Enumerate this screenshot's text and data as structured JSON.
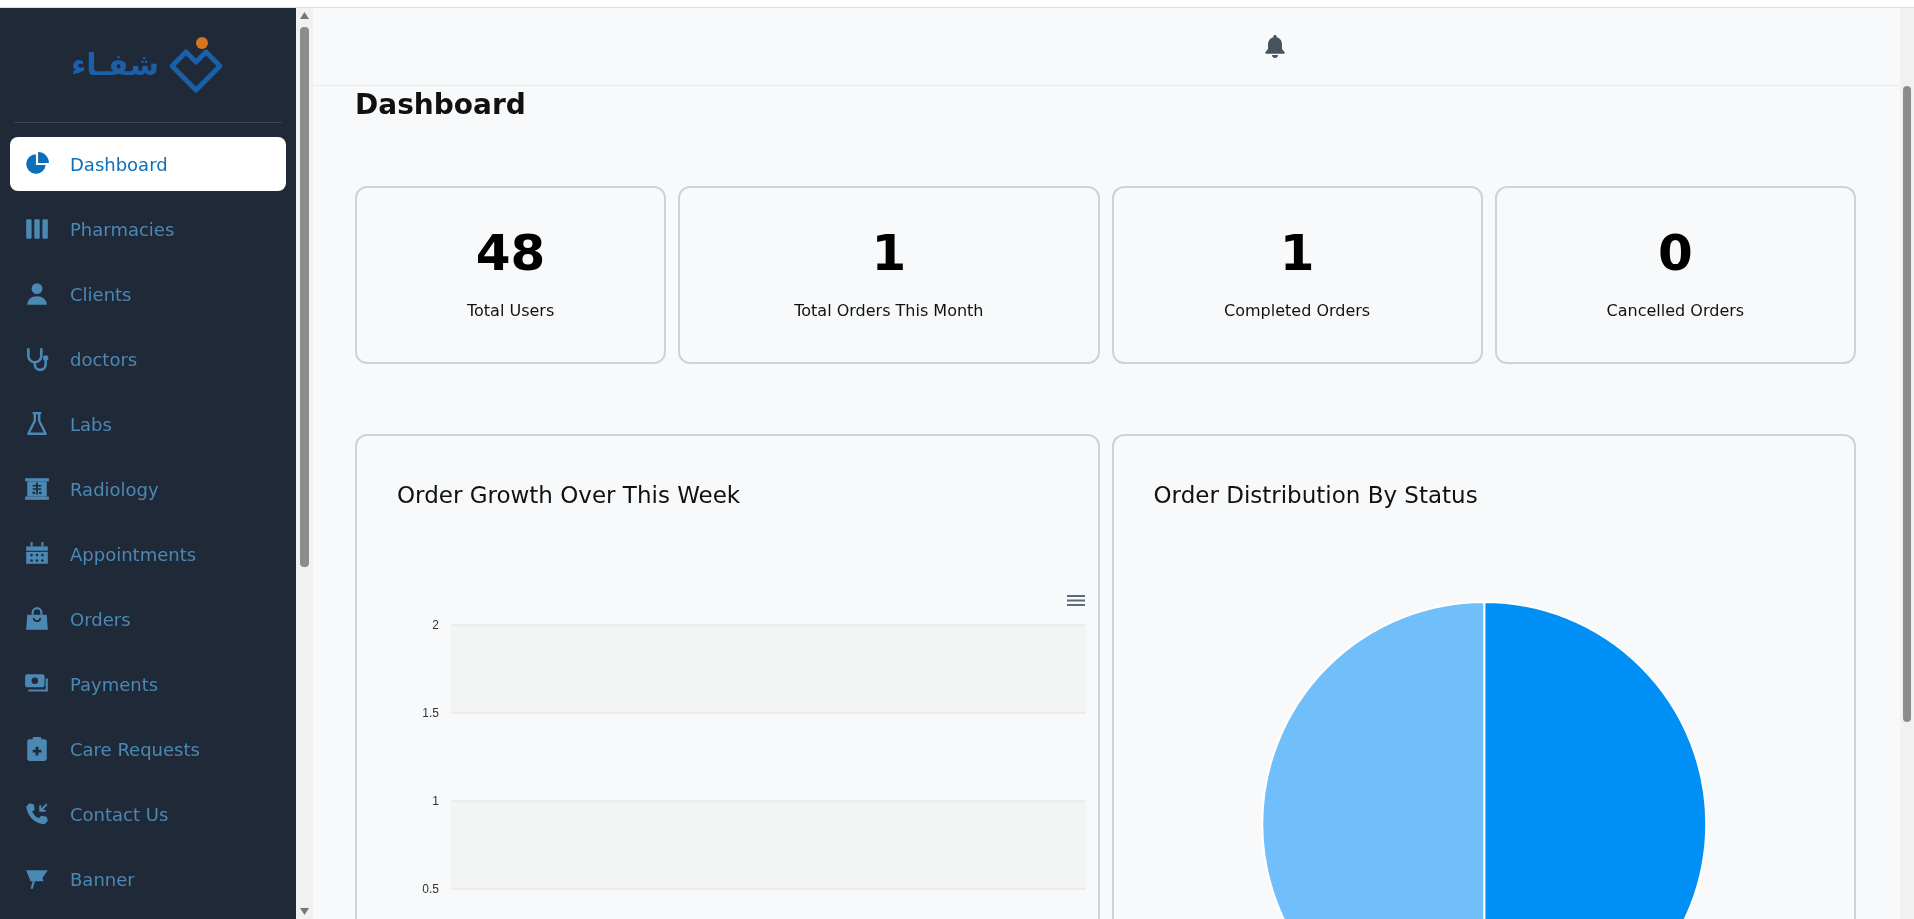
{
  "brand": {
    "name": "شفـاء"
  },
  "sidebar": {
    "items": [
      {
        "label": "Dashboard",
        "selected": true
      },
      {
        "label": "Pharmacies",
        "selected": false
      },
      {
        "label": "Clients",
        "selected": false
      },
      {
        "label": "doctors",
        "selected": false
      },
      {
        "label": "Labs",
        "selected": false
      },
      {
        "label": "Radiology",
        "selected": false
      },
      {
        "label": "Appointments",
        "selected": false
      },
      {
        "label": "Orders",
        "selected": false
      },
      {
        "label": "Payments",
        "selected": false
      },
      {
        "label": "Care Requests",
        "selected": false
      },
      {
        "label": "Contact Us",
        "selected": false
      },
      {
        "label": "Banner",
        "selected": false
      }
    ]
  },
  "page_title": "Dashboard",
  "stats": [
    {
      "value": "48",
      "label": "Total Users"
    },
    {
      "value": "1",
      "label": "Total Orders This Month"
    },
    {
      "value": "1",
      "label": "Completed Orders"
    },
    {
      "value": "0",
      "label": "Cancelled Orders"
    }
  ],
  "order_growth": {
    "title": "Order Growth Over This Week",
    "y_axis_labels": [
      "2",
      "1.5",
      "1",
      "0.5"
    ]
  },
  "order_distribution": {
    "title": "Order Distribution By Status"
  }
}
